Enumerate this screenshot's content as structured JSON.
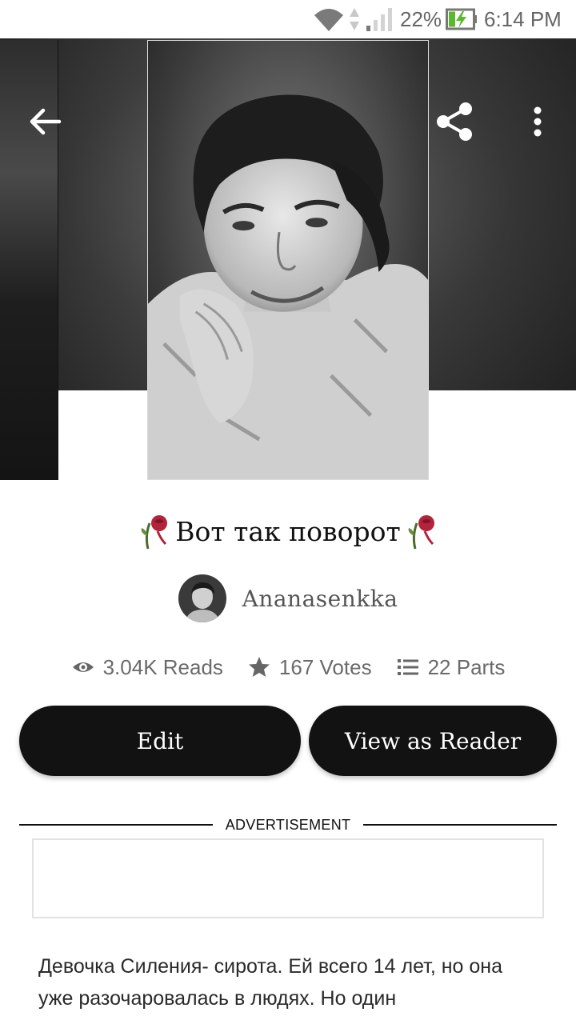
{
  "status_bar": {
    "battery_percent": "22%",
    "time": "6:14 PM",
    "icons": [
      "wifi-icon",
      "data-arrows-icon",
      "signal-icon",
      "battery-charging-icon"
    ]
  },
  "header": {
    "back_icon": "arrow-left-icon",
    "share_icon": "share-icon",
    "more_icon": "more-vertical-icon"
  },
  "story": {
    "title": "Вот так поворот",
    "title_decoration_icon": "rose-icon",
    "author": "Ananasenkka",
    "stats": {
      "reads": "3.04K Reads",
      "votes": "167 Votes",
      "parts": "22 Parts"
    },
    "description": "Девочка Силения- сирота. Ей всего 14 лет, но она уже разочаровалась в людях. Но один"
  },
  "actions": {
    "edit_label": "Edit",
    "view_as_reader_label": "View as Reader"
  },
  "ad": {
    "label": "ADVERTISEMENT"
  },
  "colors": {
    "button_bg": "#121212",
    "status_text": "#666666",
    "battery_accent": "#5cb82e",
    "rose": "#b3233a"
  }
}
